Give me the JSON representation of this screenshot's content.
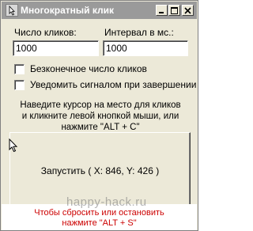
{
  "window": {
    "title": "Многократный клик",
    "controls": [
      "minimize-icon",
      "maximize-icon",
      "close-icon"
    ]
  },
  "fields": {
    "clicks_label": "Число кликов:",
    "clicks_value": "1000",
    "interval_label": "Интервал в мс.:",
    "interval_value": "1000"
  },
  "options": {
    "infinite_label": "Безконечное число кликов",
    "infinite_checked": false,
    "notify_label": "Уведомить сигналом при завершении",
    "notify_checked": false
  },
  "instructions": {
    "line1": "Наведите курсор на место для кликов",
    "line2": "и кликните левой кнопкой мыши, или",
    "line3": "нажмите \"ALT + C\""
  },
  "start_button": {
    "label": "Запустить ( X: 846, Y: 426 )"
  },
  "hint": {
    "line1": "Чтобы сбросить или остановить",
    "line2": "нажмите \"ALT + S\""
  },
  "watermark": "happy-hack.ru",
  "colors": {
    "titlebar": "#9a9a9a",
    "hint": "#cc0000",
    "face": "#ece9d8"
  }
}
